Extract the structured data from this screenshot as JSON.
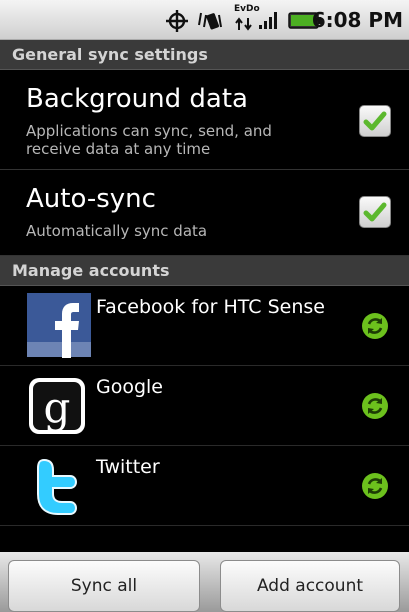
{
  "status_bar": {
    "time": "6:08 PM",
    "network_label": "EvDo",
    "icons": [
      "gps-icon",
      "vibrate-icon",
      "data-arrows-icon",
      "signal-icon",
      "battery-icon"
    ]
  },
  "general_sync": {
    "header": "General sync settings",
    "background_data": {
      "title": "Background data",
      "summary": "Applications can sync, send, and receive data at any time",
      "checked": true
    },
    "auto_sync": {
      "title": "Auto-sync",
      "summary": "Automatically sync data",
      "checked": true
    }
  },
  "manage_accounts": {
    "header": "Manage accounts",
    "accounts": [
      {
        "name": "Facebook for HTC Sense",
        "icon": "facebook-icon",
        "sync_icon": "sync-icon"
      },
      {
        "name": "Google",
        "icon": "google-icon",
        "sync_icon": "sync-icon"
      },
      {
        "name": "Twitter",
        "icon": "twitter-icon",
        "sync_icon": "sync-icon"
      }
    ]
  },
  "bottom_bar": {
    "sync_all_label": "Sync all",
    "add_account_label": "Add account"
  },
  "colors": {
    "check_green": "#5cb82e",
    "sync_green": "#6cc11d",
    "facebook_blue": "#3b5998",
    "twitter_blue": "#33ccff"
  }
}
